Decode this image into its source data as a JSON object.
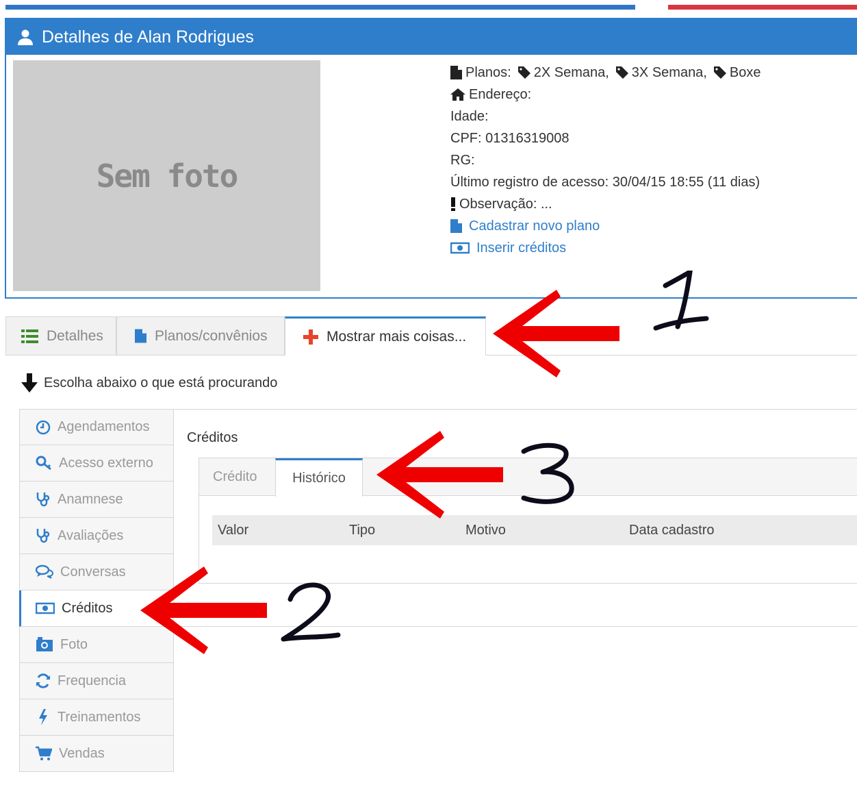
{
  "header": {
    "title": "Detalhes de Alan Rodrigues"
  },
  "photo": {
    "placeholder": "Sem foto"
  },
  "info": {
    "planos_label": "Planos:",
    "planos": [
      "2X Semana,",
      "3X Semana,",
      "Boxe"
    ],
    "endereco": "Endereço:",
    "idade": "Idade:",
    "cpf": "CPF: 01316319008",
    "rg": "RG:",
    "ultimo_acesso": "Último registro de acesso: 30/04/15 18:55 (11 dias)",
    "observacao": "Observação: ...",
    "link_novo_plano": "Cadastrar novo plano",
    "link_inserir_creditos": "Inserir créditos"
  },
  "tabs": [
    "Detalhes",
    "Planos/convênios",
    "Mostrar mais coisas..."
  ],
  "hint": "Escolha abaixo o que está procurando",
  "sidebar": {
    "items": [
      {
        "label": "Agendamentos",
        "icon": "clock-icon"
      },
      {
        "label": "Acesso externo",
        "icon": "key-icon"
      },
      {
        "label": "Anamnese",
        "icon": "stethoscope-icon"
      },
      {
        "label": "Avaliações",
        "icon": "stethoscope-icon"
      },
      {
        "label": "Conversas",
        "icon": "chat-icon"
      },
      {
        "label": "Créditos",
        "icon": "money-icon"
      },
      {
        "label": "Foto",
        "icon": "camera-icon"
      },
      {
        "label": "Frequencia",
        "icon": "refresh-icon"
      },
      {
        "label": "Treinamentos",
        "icon": "bolt-icon"
      },
      {
        "label": "Vendas",
        "icon": "cart-icon"
      }
    ],
    "active": "Créditos"
  },
  "content": {
    "title": "Créditos",
    "subtabs": [
      "Crédito",
      "Histórico"
    ],
    "active_subtab": "Histórico",
    "columns": [
      "Valor",
      "Tipo",
      "Motivo",
      "Data cadastro"
    ]
  },
  "annotations": [
    "1",
    "2",
    "3"
  ],
  "colors": {
    "primary": "#2f7ecb",
    "arrow": "#ee0000",
    "accent_red": "#d9363e"
  }
}
